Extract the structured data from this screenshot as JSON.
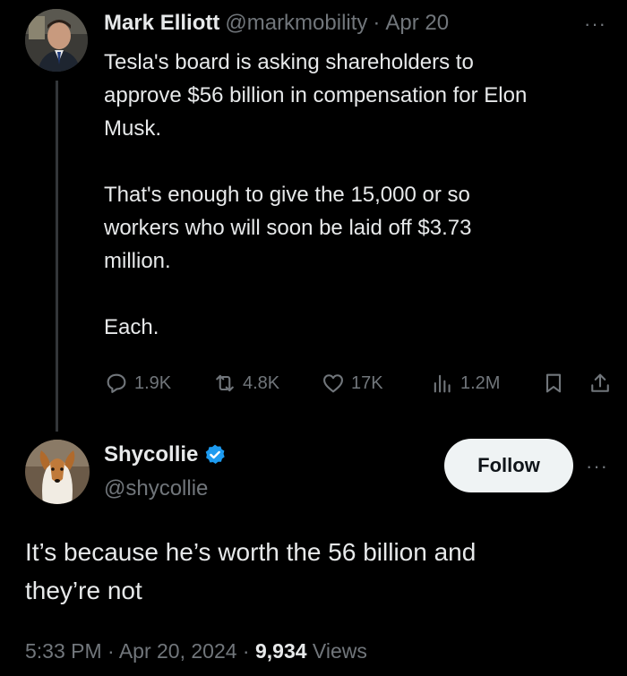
{
  "parent_tweet": {
    "author_name": "Mark Elliott",
    "author_handle": "@markmobility",
    "separator": "·",
    "date": "Apr 20",
    "more_label": "···",
    "paragraphs": [
      "Tesla's board is asking shareholders to approve $56 billion in compensation for Elon Musk.",
      "That's enough to give the 15,000 or so workers who will soon be laid off $3.73 million.",
      "Each."
    ],
    "lines": [
      "Tesla's board is asking shareholders to",
      "approve $56 billion in compensation for Elon",
      "Musk.",
      "That's enough to give the 15,000 or so",
      "workers who will soon be laid off $3.73",
      "million.",
      "Each."
    ],
    "actions": {
      "replies": "1.9K",
      "reposts": "4.8K",
      "likes": "17K",
      "views": "1.2M"
    }
  },
  "reply_tweet": {
    "author_name": "Shycollie",
    "author_handle": "@shycollie",
    "verified": true,
    "follow_label": "Follow",
    "more_label": "···",
    "lines": [
      "It’s because he’s worth the 56 billion and",
      "they’re not"
    ],
    "timestamp": "5:33 PM · Apr 20, 2024 · ",
    "views_count": "9,934",
    "views_label": " Views"
  },
  "colors": {
    "background": "#000000",
    "text": "#e7e9ea",
    "muted": "#71767b",
    "verified_blue": "#1d9bf0",
    "follow_bg": "#eff3f4",
    "thread_line": "#333639"
  }
}
